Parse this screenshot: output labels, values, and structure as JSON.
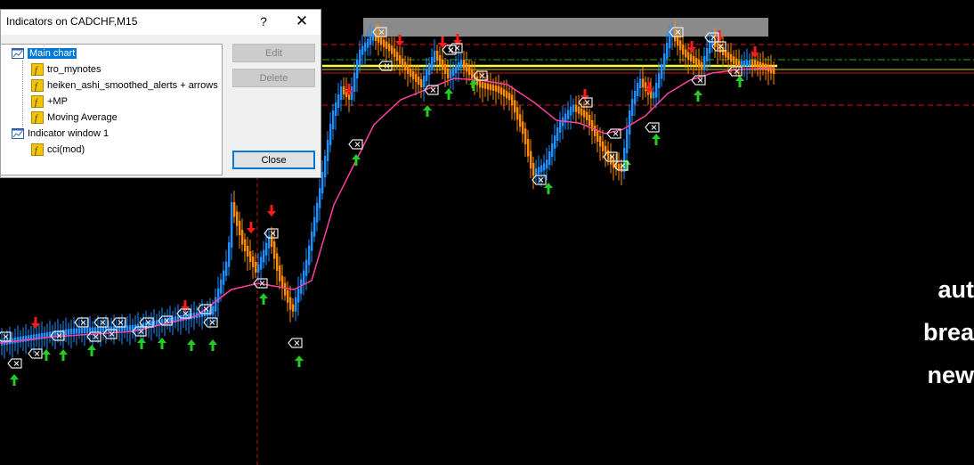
{
  "dialog": {
    "title": "Indicators on CADCHF,M15",
    "help_glyph": "?",
    "close_glyph": "✕",
    "tree": [
      {
        "label": "Main chart",
        "level": 0,
        "icon": "chart-window-icon",
        "selected": true
      },
      {
        "label": "tro_mynotes",
        "level": 1,
        "icon": "indicator-f-icon"
      },
      {
        "label": "heiken_ashi_smoothed_alerts + arrows",
        "level": 1,
        "icon": "indicator-f-icon"
      },
      {
        "label": "+MP",
        "level": 1,
        "icon": "indicator-f-icon"
      },
      {
        "label": "Moving Average",
        "level": 1,
        "icon": "indicator-f-icon"
      },
      {
        "label": "Indicator window 1",
        "level": 0,
        "icon": "chart-window-icon"
      },
      {
        "label": "cci(mod)",
        "level": 1,
        "icon": "indicator-f-icon"
      }
    ],
    "buttons": {
      "edit": "Edit",
      "delete": "Delete",
      "close": "Close"
    }
  },
  "overlay_text": [
    "aut",
    "brea",
    "new"
  ],
  "colors": {
    "bull": "#1e90ff",
    "bear": "#ff8c00",
    "ma": "#ff3fa0",
    "up_arrow": "#22cc22",
    "down_arrow": "#ff1a1a",
    "sr_line": "#ffff00"
  }
}
